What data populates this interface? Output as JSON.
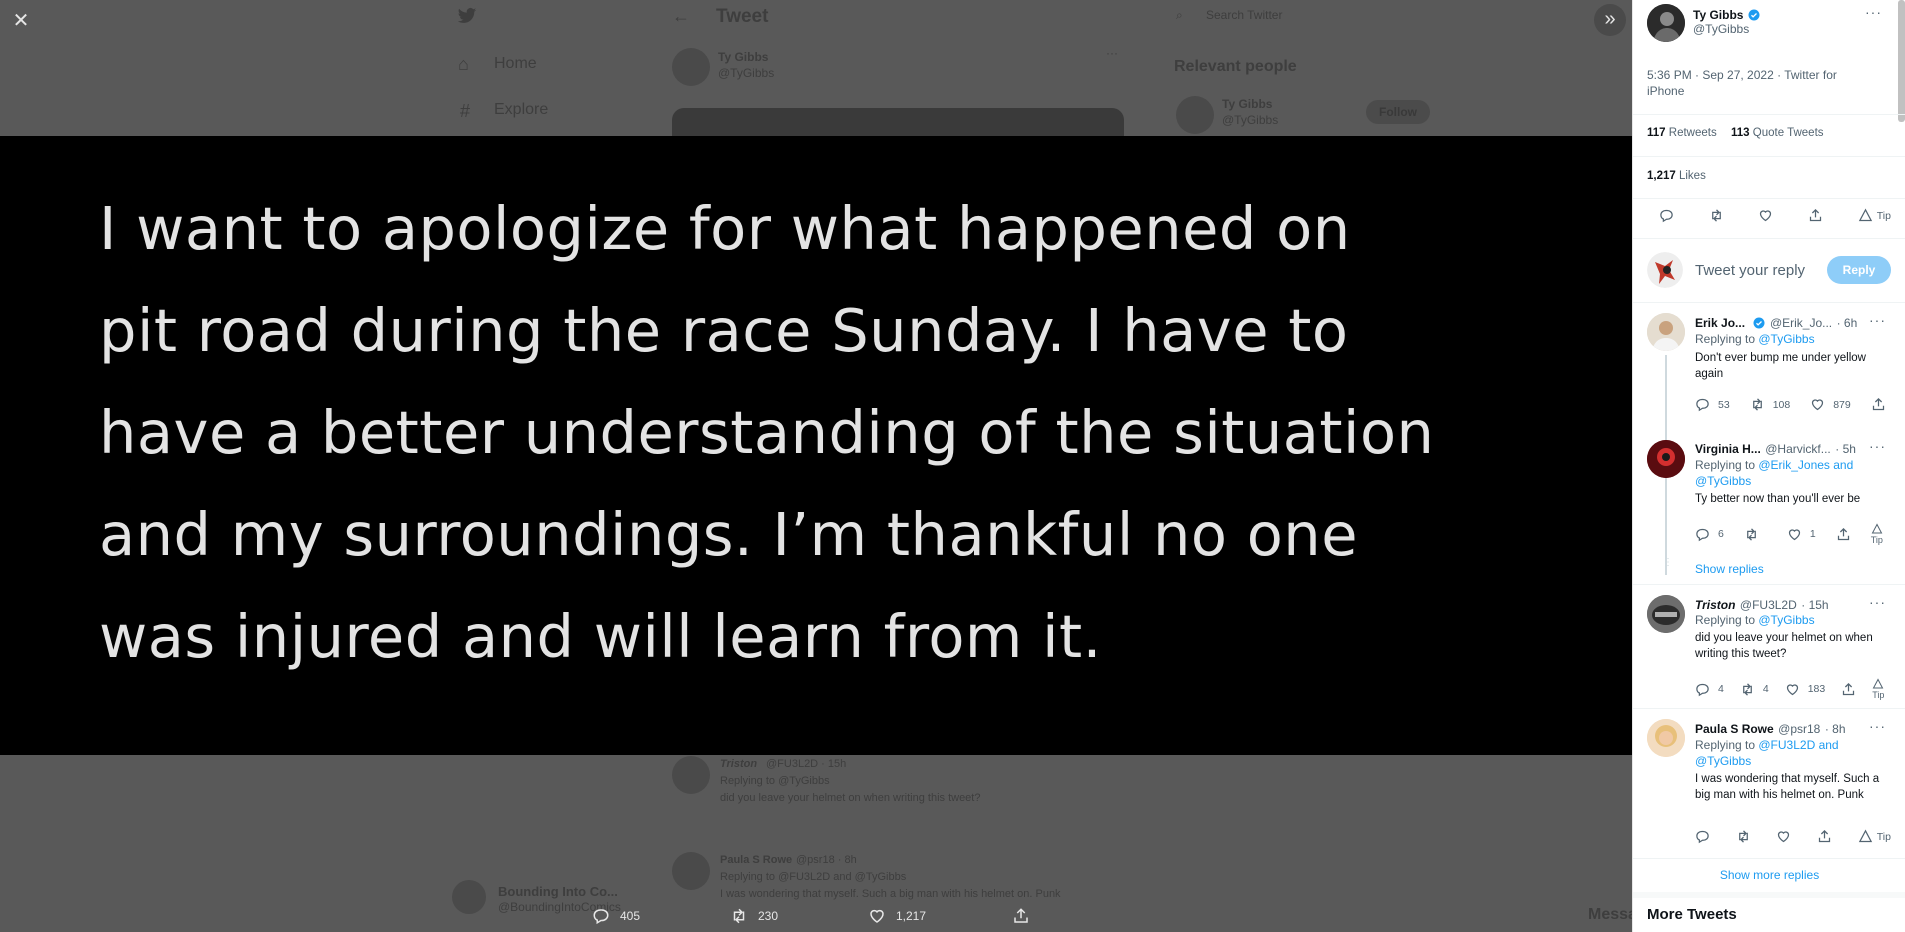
{
  "background_page": {
    "nav": {
      "home": "Home",
      "explore": "Explore"
    },
    "header_title": "Tweet",
    "author_name": "Ty Gibbs",
    "author_handle": "@TyGibbs",
    "search_placeholder": "Search Twitter",
    "relevant_people_title": "Relevant people",
    "follow_label": "Follow",
    "reply_preview_1": {
      "name": "Triston",
      "handle": "@FU3L2D · 15h",
      "replying": "Replying to @TyGibbs",
      "text": "did you leave your helmet on when writing this tweet?"
    },
    "reply_preview_2": {
      "name": "Paula S Rowe",
      "handle": "@psr18 · 8h",
      "replying": "Replying to @FU3L2D and @TyGibbs",
      "text": "I was wondering that myself.  Such a big man with his helmet on.  Punk"
    },
    "account_name": "Bounding Into Co...",
    "account_handle": "@BoundingIntoComics",
    "messages_label": "Messages"
  },
  "media": {
    "lines": [
      "I want to apologize for what happened on",
      "pit road during the race Sunday. I have to",
      "have a better understanding of the situation",
      "and my surroundings. I’m thankful no one",
      "was injured and will learn from it."
    ],
    "actions": {
      "replies": "405",
      "retweets": "230",
      "likes": "1,217"
    }
  },
  "panel": {
    "author": {
      "name": "Ty Gibbs",
      "handle": "@TyGibbs"
    },
    "timestamp_line1": "5:36 PM · Sep 27, 2022 · Twitter for",
    "timestamp_line2": "iPhone",
    "stats": {
      "retweets_count": "117",
      "retweets_label": "Retweets",
      "quotes_count": "113",
      "quotes_label": "Quote Tweets",
      "likes_count": "1,217",
      "likes_label": "Likes"
    },
    "tip_label": "Tip",
    "compose_placeholder": "Tweet your reply",
    "reply_button": "Reply",
    "replies": [
      {
        "name": "Erik Jo...",
        "handle": "@Erik_Jo...",
        "time": "· 6h",
        "replying_prefix": "Replying to ",
        "replying_to": "@TyGibbs",
        "text": "Don't ever bump me under yellow again",
        "reply_count": "53",
        "retweet_count": "108",
        "like_count": "879"
      },
      {
        "name": "Virginia H...",
        "handle": "@Harvickf...",
        "time": "· 5h",
        "replying_prefix": "Replying to ",
        "replying_to": "@Erik_Jones and @TyGibbs",
        "text": "Ty better now than you'll ever be",
        "reply_count": "6",
        "retweet_count": "",
        "like_count": "1",
        "show_replies": "Show replies"
      },
      {
        "name": "Triston",
        "handle": "@FU3L2D",
        "time": "· 15h",
        "replying_prefix": "Replying to ",
        "replying_to": "@TyGibbs",
        "text": "did you leave your helmet on when writing this tweet?",
        "reply_count": "4",
        "retweet_count": "4",
        "like_count": "183"
      },
      {
        "name": "Paula S Rowe",
        "handle": "@psr18",
        "time": "· 8h",
        "replying_prefix": "Replying to ",
        "replying_to": "@FU3L2D and @TyGibbs",
        "text": "I was wondering that myself.  Such a big man with his helmet on.  Punk",
        "reply_count": "",
        "retweet_count": "",
        "like_count": ""
      }
    ],
    "show_more": "Show more replies",
    "more_tweets": "More Tweets"
  },
  "colors": {
    "accent": "#1d9bf0",
    "reply_button_bg": "#8ecdf8",
    "media_bg": "#000000",
    "overlay_bg": "#595959"
  }
}
